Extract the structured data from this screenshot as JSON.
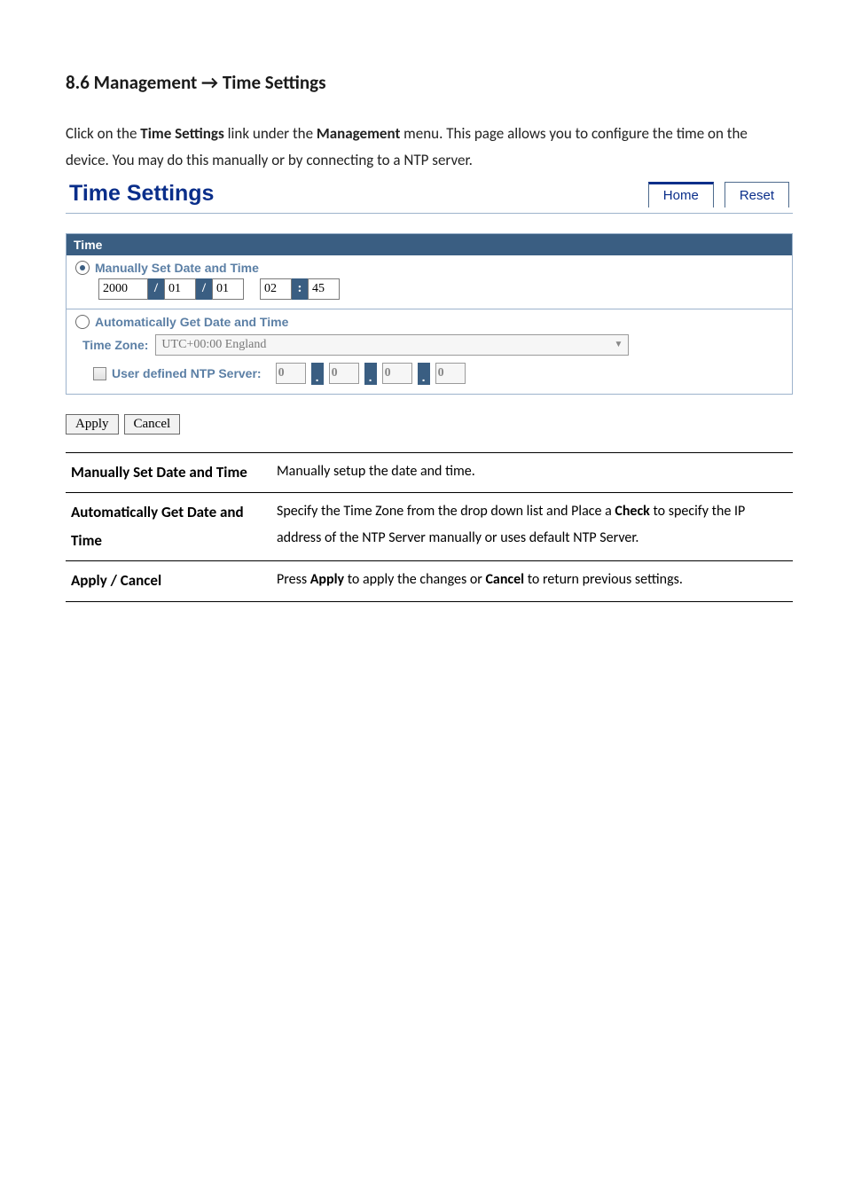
{
  "heading": "8.6 Management → Time Settings",
  "intro": {
    "t1": "Click on the ",
    "b1": "Time Settings",
    "t2": " link under the ",
    "b2": "Management",
    "t3": " menu. This page allows you to configure the time on the device. You may do this manually or by connecting to a NTP server."
  },
  "panel": {
    "title": "Time Settings",
    "tabs": {
      "home": "Home",
      "reset": "Reset"
    },
    "section_header": "Time",
    "manual": {
      "label": "Manually Set Date and Time",
      "year": "2000",
      "month": "01",
      "day": "01",
      "hour": "02",
      "minute": "45"
    },
    "auto": {
      "label": "Automatically Get Date and Time",
      "tz_label": "Time Zone:",
      "tz_value": "UTC+00:00 England",
      "ntp_label": "User defined NTP Server:",
      "ip": {
        "a": "0",
        "b": "0",
        "c": "0",
        "d": "0"
      }
    },
    "buttons": {
      "apply": "Apply",
      "cancel": "Cancel"
    }
  },
  "desc": {
    "r1_label": "Manually Set Date and Time",
    "r1_text": "Manually setup the date and time.",
    "r2_label": "Automatically Get Date and Time",
    "r2_t1": "Specify the Time Zone from the drop down list and Place a ",
    "r2_b1": "Check",
    "r2_t2": " to specify the IP address of the NTP Server manually or uses default NTP Server.",
    "r3_label": "Apply / Cancel",
    "r3_t1": "Press ",
    "r3_b1": "Apply",
    "r3_t2": " to apply the changes or ",
    "r3_b2": "Cancel",
    "r3_t3": " to return previous settings."
  }
}
